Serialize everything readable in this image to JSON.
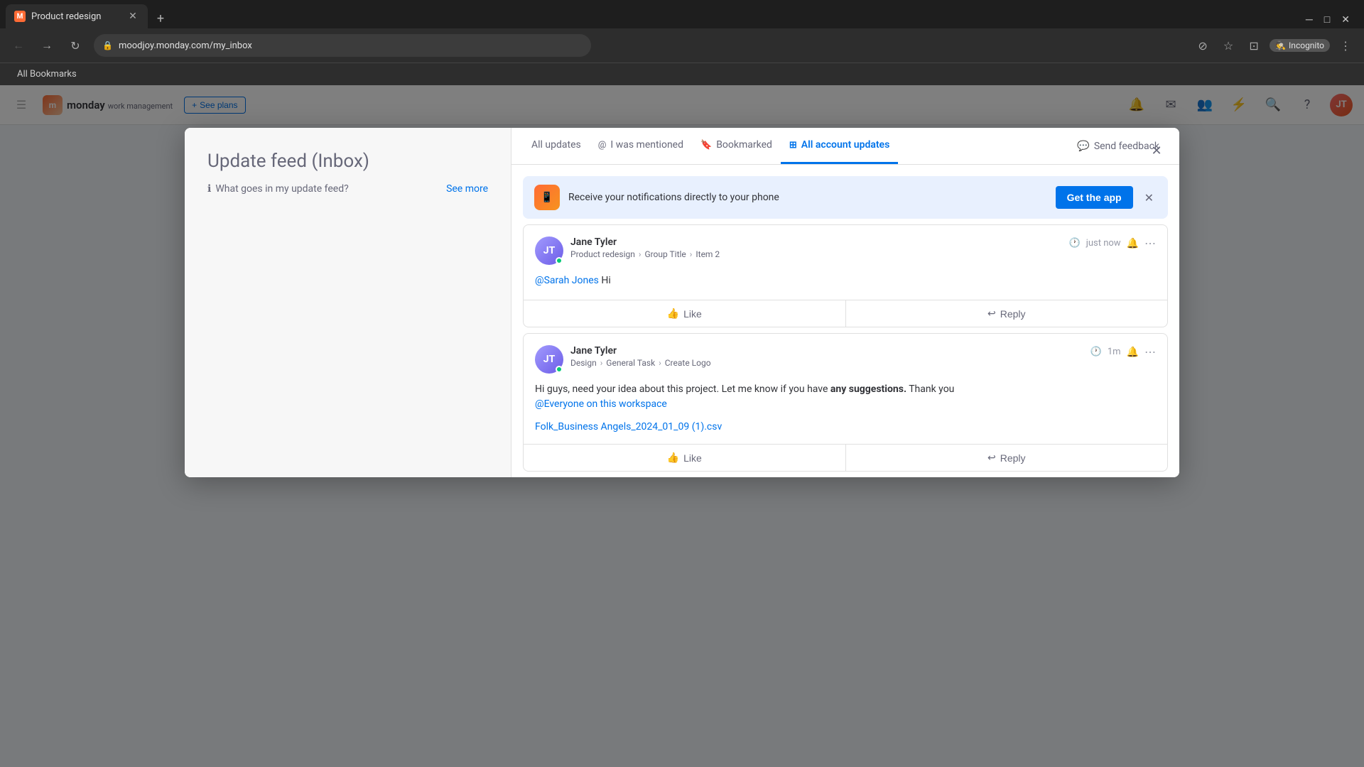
{
  "browser": {
    "tab_title": "Product redesign",
    "tab_favicon": "M",
    "url": "moodjoy.monday.com/my_inbox",
    "new_tab_symbol": "+",
    "incognito_label": "Incognito",
    "bookmarks_label": "All Bookmarks"
  },
  "monday": {
    "logo_text": "monday",
    "logo_sub": "work management",
    "see_plans_label": "See plans"
  },
  "modal": {
    "title": "Update feed",
    "title_sub": "(Inbox)",
    "info_text": "What goes in my update feed?",
    "see_more_label": "See more"
  },
  "tabs": {
    "all_updates": "All updates",
    "mentioned": "I was mentioned",
    "bookmarked": "Bookmarked",
    "all_account": "All account updates",
    "send_feedback": "Send feedback",
    "active_tab": "all_account"
  },
  "notification_banner": {
    "text": "Receive your notifications directly to your phone",
    "button_label": "Get the app"
  },
  "update_card_1": {
    "user_name": "Jane Tyler",
    "breadcrumb_1": "Product redesign",
    "breadcrumb_2": "Group Title",
    "breadcrumb_3": "Item 2",
    "time_label": "just now",
    "mention": "@Sarah Jones",
    "message": " Hi",
    "like_label": "Like",
    "reply_label": "Reply"
  },
  "update_card_2": {
    "user_name": "Jane Tyler",
    "breadcrumb_1": "Design",
    "breadcrumb_2": "General Task",
    "breadcrumb_3": "Create Logo",
    "time_label": "1m",
    "message_start": "Hi guys, need your idea about this project. Let me know if you have ",
    "message_bold": "any suggestions.",
    "message_end": " Thank you",
    "mention_everyone": "@Everyone on this workspace",
    "file_name": "Folk_Business Angels_2024_01_09 (1).csv",
    "like_label": "Like",
    "reply_label": "Reply"
  }
}
